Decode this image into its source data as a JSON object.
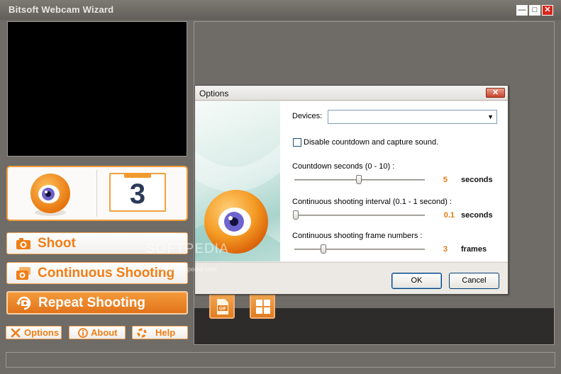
{
  "app": {
    "title": "Bitsoft Webcam Wizard"
  },
  "counter": {
    "value": "3"
  },
  "buttons": {
    "shoot": "Shoot",
    "continuous": "Continuous Shooting",
    "repeat": "Repeat Shooting",
    "options": "Options",
    "about": "About",
    "help": "Help"
  },
  "dialog": {
    "title": "Options",
    "devices_label": "Devices:",
    "devices_value": "",
    "disable_sound_label": "Disable countdown and capture sound.",
    "disable_sound_checked": false,
    "countdown": {
      "label": "Countdown seconds (0 - 10) :",
      "value": "5",
      "unit": "seconds",
      "min": 0,
      "max": 10
    },
    "interval": {
      "label": "Continuous shooting interval (0.1 - 1 second) :",
      "value": "0.1",
      "unit": "seconds",
      "min": 0.1,
      "max": 1
    },
    "frames": {
      "label": "Continuous shooting frame numbers :",
      "value": "3",
      "unit": "frames"
    },
    "ok": "OK",
    "cancel": "Cancel"
  },
  "watermark": {
    "text": "SOFTPEDIA",
    "url": "www.softpedia.com"
  },
  "colors": {
    "accent": "#f07e16",
    "frame": "#6f6b66",
    "dialog_bg": "#ece9e4"
  },
  "icons": [
    "camera-icon",
    "multi-camera-icon",
    "repeat-camera-icon",
    "tools-icon",
    "info-icon",
    "lifebuoy-icon",
    "gif-icon",
    "grid-icon",
    "eye-mascot-icon"
  ]
}
